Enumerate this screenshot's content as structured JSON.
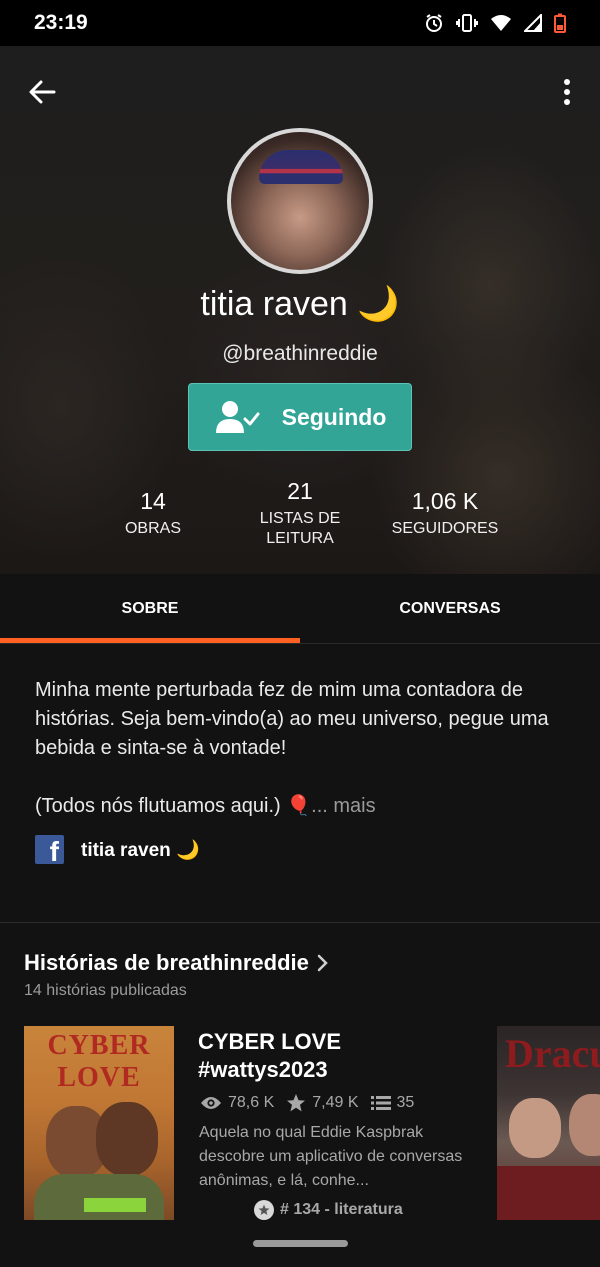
{
  "status_bar": {
    "time": "23:19",
    "icons": [
      "alarm-icon",
      "vibrate-icon",
      "wifi-icon",
      "signal-icon",
      "battery-low-icon"
    ]
  },
  "profile": {
    "name": "titia raven 🌙",
    "handle": "@breathinreddie",
    "follow_button": {
      "label": "Seguindo",
      "icon": "user-check-icon",
      "color": "#32a597"
    },
    "stats": [
      {
        "value": "14",
        "label": "OBRAS"
      },
      {
        "value": "21",
        "label": "LISTAS DE\nLEITURA"
      },
      {
        "value": "1,06 K",
        "label": "SEGUIDORES"
      }
    ]
  },
  "tabs": [
    {
      "label": "SOBRE",
      "active": true
    },
    {
      "label": "CONVERSAS",
      "active": false
    }
  ],
  "accent_color": "#ff6122",
  "about": {
    "text_1": "Minha mente perturbada fez de mim uma contadora de histórias. Seja bem-vindo(a) ao meu universo, pegue uma bebida e sinta-se à vontade!",
    "text_2": "(Todos nós flutuamos aqui.) 🎈",
    "more": "... mais",
    "facebook_name": "titia raven 🌙"
  },
  "stories": {
    "title": "Histórias de breathinreddie",
    "subtitle": "14 histórias publicadas",
    "items": [
      {
        "cover_title": "CYBER LOVE",
        "title": "CYBER LOVE #wattys2023",
        "reads": "78,6 K",
        "votes": "7,49 K",
        "parts": "35",
        "description": "Aquela no qual Eddie Kaspbrak descobre um aplicativo de conversas anônimas, e lá, conhe...",
        "rank": "# 134 - literatura"
      },
      {
        "cover_title": "Dracu"
      }
    ]
  }
}
